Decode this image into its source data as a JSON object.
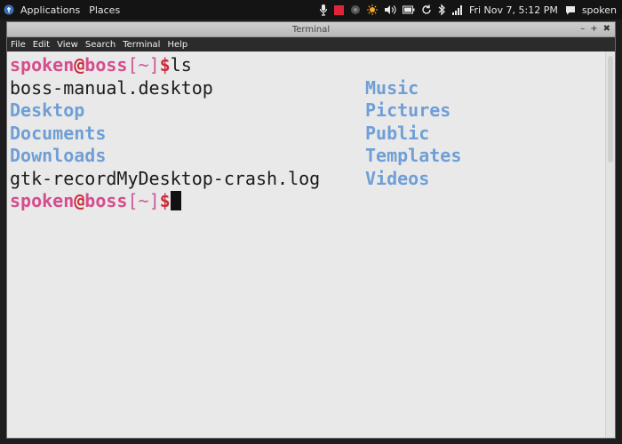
{
  "topbar": {
    "applications_label": "Applications",
    "places_label": "Places",
    "clock": "Fri Nov 7,  5:12 PM",
    "user": "spoken"
  },
  "window": {
    "title": "Terminal",
    "controls": {
      "minimize": "–",
      "maximize": "+",
      "close": "✖"
    }
  },
  "menubar": {
    "items": [
      "File",
      "Edit",
      "View",
      "Search",
      "Terminal",
      "Help"
    ]
  },
  "terminal": {
    "prompt": {
      "user": "spoken",
      "at": "@",
      "host": "boss",
      "open_bracket": "[",
      "cwd": "~",
      "close_bracket": "]",
      "symbol": "$"
    },
    "command": "ls",
    "listing": [
      {
        "left": "boss-manual.desktop",
        "left_is_dir": false,
        "right": "Music"
      },
      {
        "left": "Desktop",
        "left_is_dir": true,
        "right": "Pictures"
      },
      {
        "left": "Documents",
        "left_is_dir": true,
        "right": "Public"
      },
      {
        "left": "Downloads",
        "left_is_dir": true,
        "right": "Templates"
      },
      {
        "left": "gtk-recordMyDesktop-crash.log",
        "left_is_dir": false,
        "right": "Videos"
      }
    ]
  },
  "colors": {
    "directory": "#6f9fd6",
    "prompt_user": "#d64d8d",
    "prompt_symbol": "#cc2a3a",
    "terminal_bg": "#e9e9e9",
    "topbar_bg": "#141414"
  },
  "icons": {
    "app_menu": "fedora-logo-icon",
    "tray": [
      "microphone-icon",
      "record-stop-icon",
      "network-icon",
      "weather-icon",
      "volume-icon",
      "battery-icon",
      "refresh-icon",
      "bluetooth-icon",
      "signal-icon",
      "chat-icon"
    ]
  }
}
